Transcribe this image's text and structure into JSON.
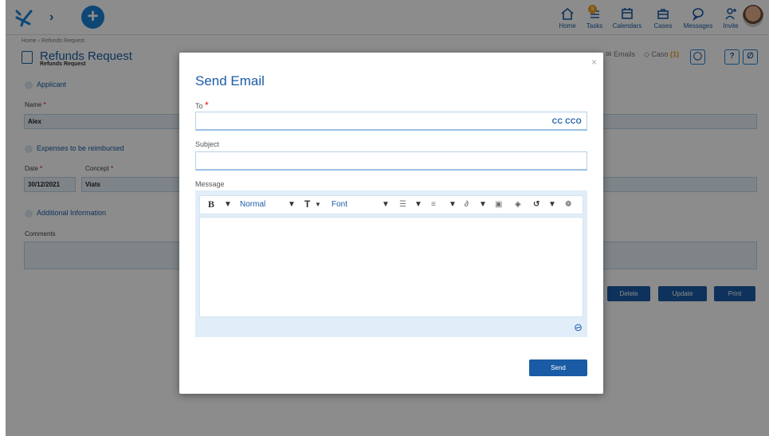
{
  "topbar": {
    "nav": [
      {
        "label": "Home"
      },
      {
        "label": "Tasks",
        "badge": "9"
      },
      {
        "label": "Calendars"
      },
      {
        "label": "Cases"
      },
      {
        "label": "Messages"
      },
      {
        "label": "Invite"
      }
    ]
  },
  "breadcrumb": "Home › Refunds Request",
  "page": {
    "title": "Refunds Request",
    "subtitle": "Refunds Request"
  },
  "sections": {
    "applicant": "Applicant",
    "expenses": "Expenses to be reimbursed",
    "additional": "Additional Information"
  },
  "fields": {
    "name_label": "Name",
    "name_value": "Alex",
    "date_label": "Date",
    "date_value": "30/12/2021",
    "concept_label": "Concept",
    "concept_value": "Viats",
    "comments_label": "Comments"
  },
  "toolbar_right": {
    "emails": "Emails",
    "caso": "Caso",
    "caso_count": "(1)",
    "help": "?"
  },
  "buttons": {
    "delete": "Delete",
    "update": "Update",
    "print": "Print"
  },
  "modal": {
    "title": "Send Email",
    "to_label": "To",
    "cc_label": "CC CCO",
    "subject_label": "Subject",
    "message_label": "Message",
    "editor": {
      "bold": "B",
      "style": "Normal",
      "size": "T",
      "font": "Font"
    },
    "send_label": "Send",
    "close": "×"
  },
  "colors": {
    "primary": "#1a5ba6",
    "accent": "#1a82d6",
    "required": "#e01010"
  }
}
